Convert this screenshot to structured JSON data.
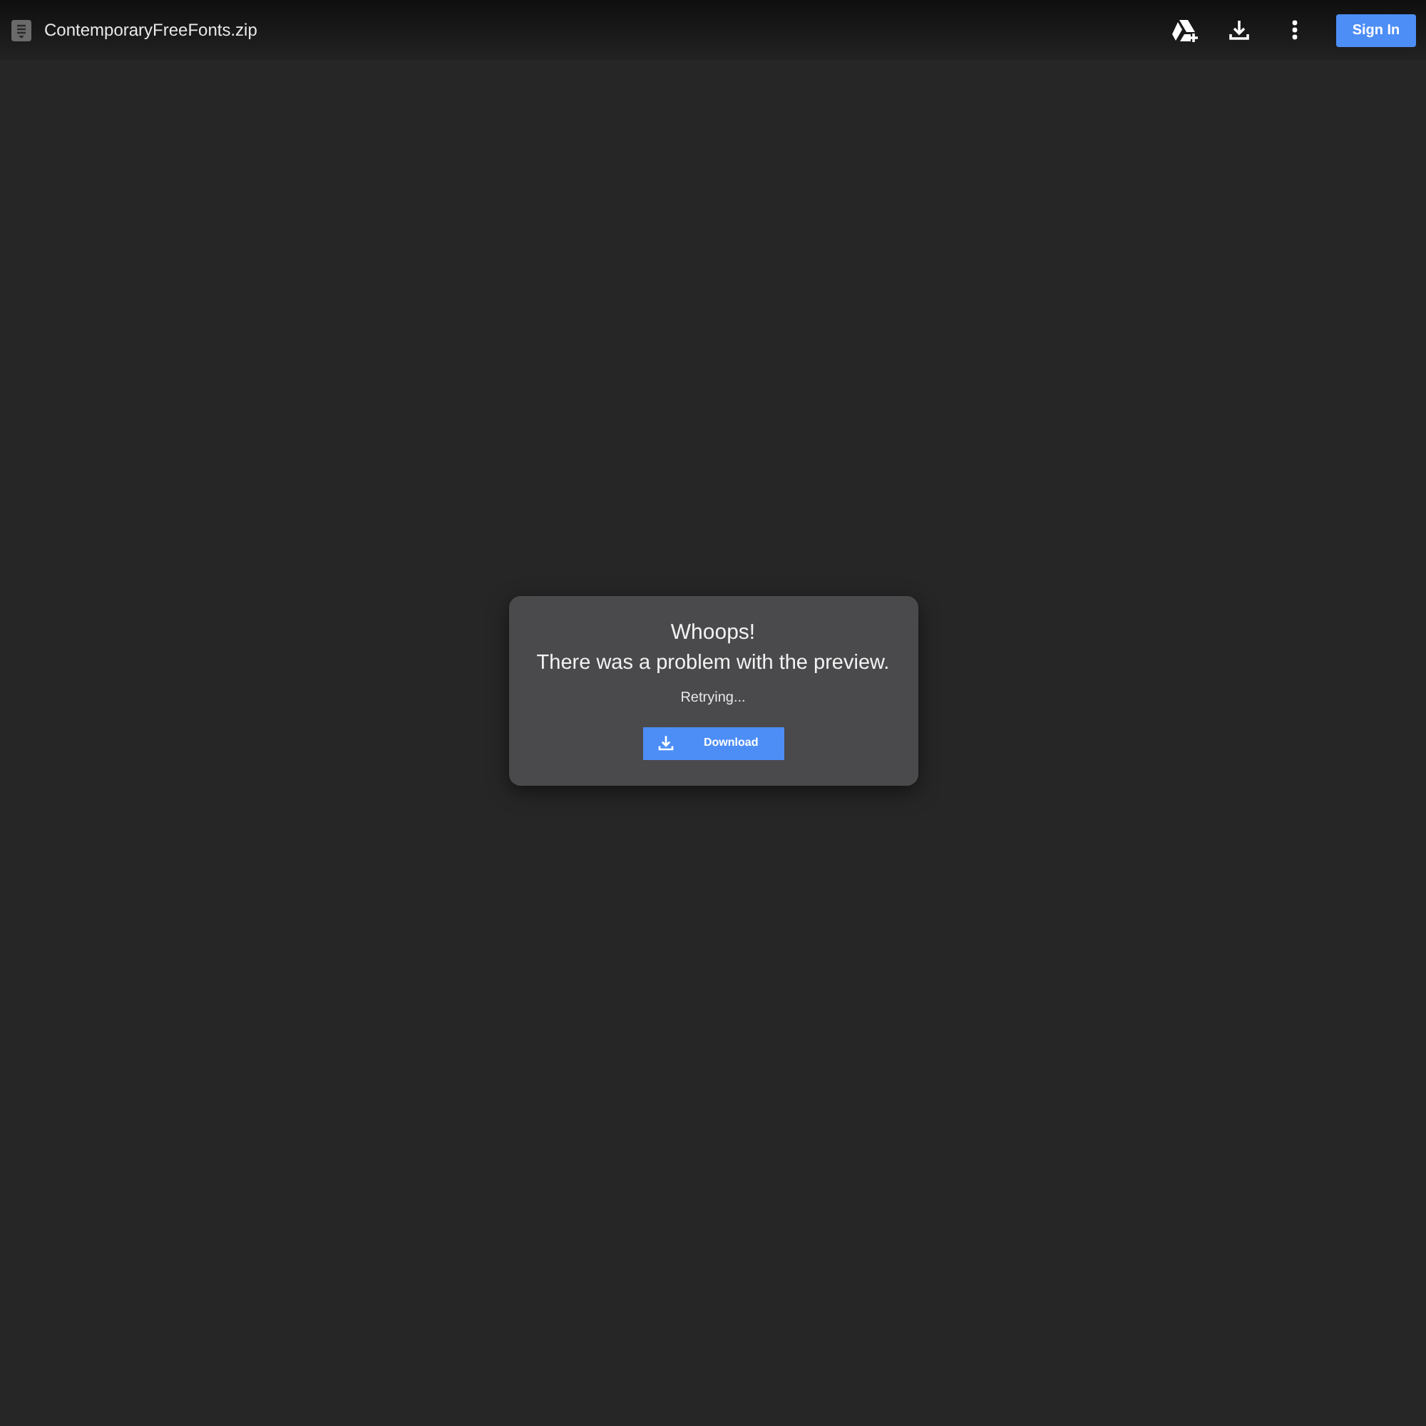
{
  "header": {
    "file_name": "ContemporaryFreeFonts.zip",
    "sign_in": "Sign In"
  },
  "dialog": {
    "title": "Whoops!",
    "message": "There was a problem with the preview.",
    "status": "Retrying...",
    "button": "Download"
  }
}
